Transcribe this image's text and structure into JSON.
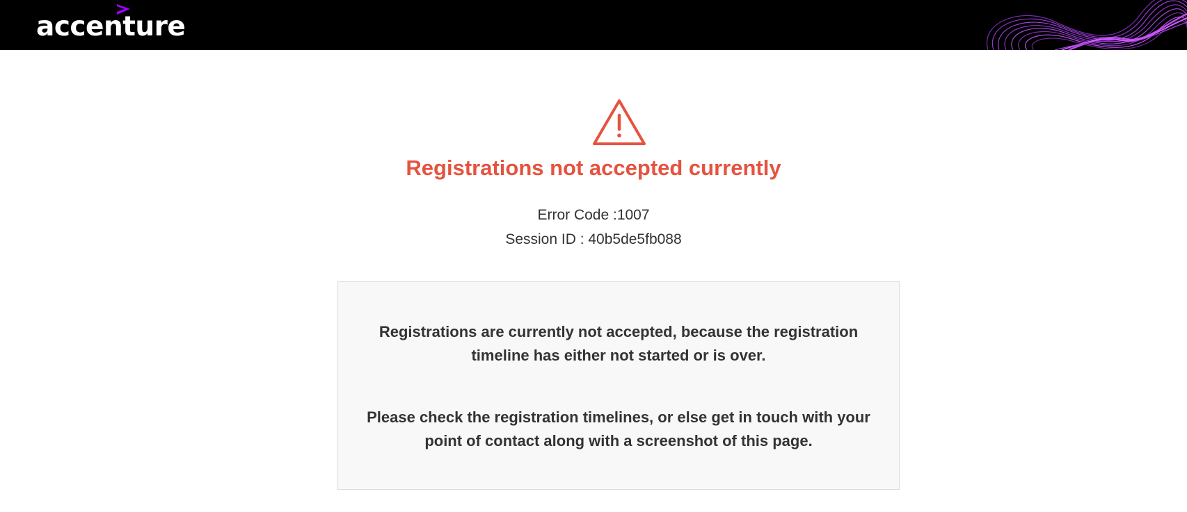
{
  "header": {
    "brand": "accenture",
    "brand_color": "#a100ff",
    "background": "#000000"
  },
  "error": {
    "icon": "warning-icon",
    "title": "Registrations not accepted currently",
    "title_color": "#e5533f",
    "code_text": "Error Code :1007",
    "session_text": "Session ID : 40b5de5fb088"
  },
  "message": {
    "paragraph_1": "Registrations are currently not accepted, because the registration timeline has either not started or is over.",
    "paragraph_2": "Please check the registration timelines, or else get in touch with your point of contact along with a screenshot of this page."
  }
}
